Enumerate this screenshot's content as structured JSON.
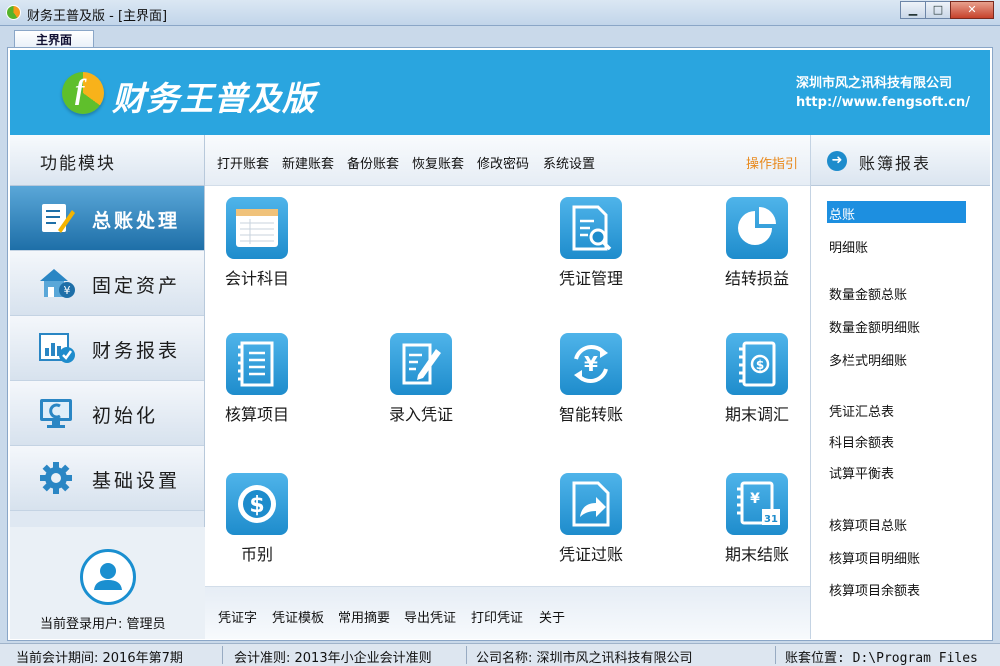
{
  "window": {
    "title": "财务王普及版 - [主界面]",
    "tab": "主界面",
    "controls": {
      "minimize": "▁",
      "maximize": "□",
      "close": "✕"
    }
  },
  "banner": {
    "brand": "财务王普及版",
    "company_name": "深圳市风之讯科技有限公司",
    "company_url": "http://www.fengsoft.cn/",
    "color": "#2aa5df"
  },
  "sidebar": {
    "header": "功能模块",
    "items": [
      {
        "label": "总账处理",
        "icon": "ledger-edit-icon",
        "active": true
      },
      {
        "label": "固定资产",
        "icon": "fixed-asset-icon",
        "active": false
      },
      {
        "label": "财务报表",
        "icon": "report-check-icon",
        "active": false
      },
      {
        "label": "初始化",
        "icon": "monitor-reset-icon",
        "active": false
      },
      {
        "label": "基础设置",
        "icon": "gear-icon",
        "active": false
      }
    ],
    "user_label": "当前登录用户: 管理员"
  },
  "toolbar": {
    "links": [
      "打开账套",
      "新建账套",
      "备份账套",
      "恢复账套",
      "修改密码",
      "系统设置"
    ],
    "guide": "操作指引"
  },
  "modules": [
    {
      "name": "会计科目",
      "icon": "ledger-table-icon"
    },
    {
      "name": "凭证管理",
      "icon": "voucher-search-icon"
    },
    {
      "name": "结转损益",
      "icon": "pie-chart-icon"
    },
    {
      "name": "核算项目",
      "icon": "document-list-icon"
    },
    {
      "name": "录入凭证",
      "icon": "edit-document-icon"
    },
    {
      "name": "智能转账",
      "icon": "yen-cycle-icon"
    },
    {
      "name": "期末调汇",
      "icon": "dollar-book-icon"
    },
    {
      "name": "币别",
      "icon": "dollar-coin-icon"
    },
    {
      "name": "凭证过账",
      "icon": "post-arrow-icon"
    },
    {
      "name": "期末结账",
      "icon": "calendar-yen-icon"
    }
  ],
  "bottom_links": [
    "凭证字",
    "凭证模板",
    "常用摘要",
    "导出凭证",
    "打印凭证",
    "关于"
  ],
  "right_panel": {
    "header": "账簿报表",
    "links": [
      {
        "label": "总账",
        "active": true
      },
      {
        "label": "明细账",
        "active": false
      },
      {
        "label": "数量金额总账",
        "active": false
      },
      {
        "label": "数量金额明细账",
        "active": false
      },
      {
        "label": "多栏式明细账",
        "active": false
      },
      {
        "label": "凭证汇总表",
        "active": false
      },
      {
        "label": "科目余额表",
        "active": false
      },
      {
        "label": "试算平衡表",
        "active": false
      },
      {
        "label": "核算项目总账",
        "active": false
      },
      {
        "label": "核算项目明细账",
        "active": false
      },
      {
        "label": "核算项目余额表",
        "active": false
      }
    ]
  },
  "status": {
    "period": "当前会计期间: 2016年第7期",
    "standard": "会计准则: 2013年小企业会计准则",
    "company": "公司名称: 深圳市风之讯科技有限公司",
    "location": "账套位置: D:\\Program Files"
  }
}
